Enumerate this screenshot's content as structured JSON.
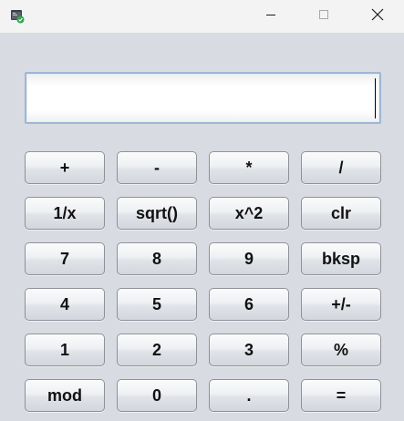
{
  "window": {
    "display_value": "",
    "controls": {
      "minimize": "minimize",
      "maximize": "maximize",
      "close": "close"
    }
  },
  "keypad": {
    "row1": [
      "+",
      "-",
      "*",
      "/"
    ],
    "row2": [
      "1/x",
      "sqrt()",
      "x^2",
      "clr"
    ],
    "row3": [
      "7",
      "8",
      "9",
      "bksp"
    ],
    "row4": [
      "4",
      "5",
      "6",
      "+/-"
    ],
    "row5": [
      "1",
      "2",
      "3",
      "%"
    ],
    "row6": [
      "mod",
      "0",
      ".",
      "="
    ]
  },
  "colors": {
    "window_background": "#d8dbe2",
    "titlebar": "#f3f3f3",
    "display_border": "#9db7d4",
    "button_border": "#8e9196",
    "app_icon_accent": "#2fa84f"
  },
  "icons": {
    "app": "app-icon",
    "minimize": "minimize-icon",
    "maximize": "maximize-icon",
    "close": "close-icon"
  }
}
